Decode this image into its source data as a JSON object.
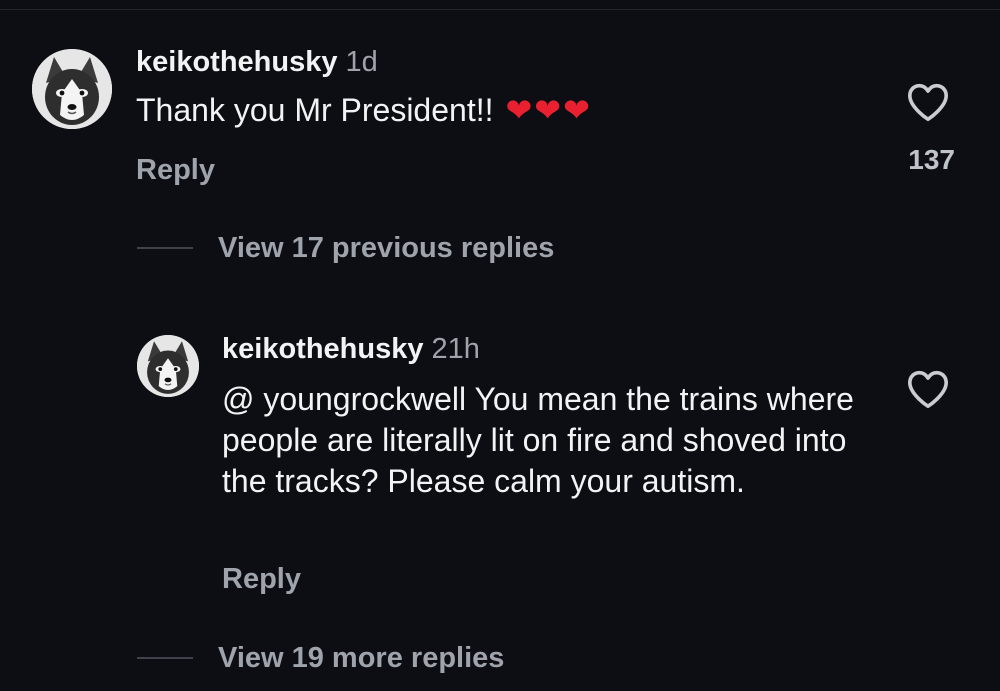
{
  "comment": {
    "username": "keikothehusky",
    "time": "1d",
    "text": "Thank you Mr President!!",
    "hearts": "❤❤❤",
    "reply_label": "Reply",
    "like_count": "137",
    "avatar_icon": "husky-avatar"
  },
  "view_previous": {
    "label": "View 17 previous replies"
  },
  "reply": {
    "username": "keikothehusky",
    "time": "21h",
    "text": "@ youngrockwell You mean the trains where people are literally lit on fire and shoved into the tracks?  Please calm your autism.",
    "reply_label": "Reply",
    "avatar_icon": "husky-avatar"
  },
  "view_more": {
    "label": "View 19 more replies"
  },
  "colors": {
    "background": "#0d0e13",
    "text_primary": "#f2f3f5",
    "text_secondary": "#9ea3ac",
    "heart": "#e8202f"
  }
}
